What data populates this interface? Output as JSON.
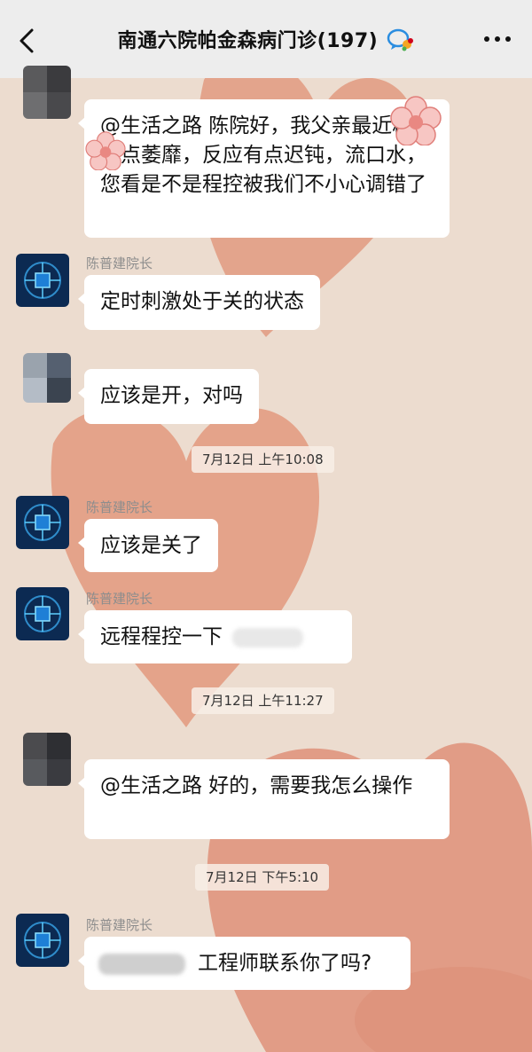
{
  "header": {
    "title": "南通六院帕金森病门诊(197)",
    "back_icon": "chevron-left-icon",
    "more_icon": "more-dots-icon",
    "badge_icon": "chat-bubble-badge-icon"
  },
  "messages": [
    {
      "sender": "",
      "text": "@生活之路  陈院好，我父亲最近精神有点萎靡，反应有点迟钝，流口水，您看是不是程控被我们不小心调错了"
    },
    {
      "sender": "陈普建院长",
      "text": "定时刺激处于关的状态"
    },
    {
      "sender": "",
      "text": "应该是开，对吗"
    },
    {
      "time": "7月12日 上午10:08"
    },
    {
      "sender": "陈普建院长",
      "text": "应该是关了"
    },
    {
      "sender": "陈普建院长",
      "text": "远程程控一下"
    },
    {
      "time": "7月12日 上午11:27"
    },
    {
      "sender": "",
      "text": "@生活之路  好的，需要我怎么操作"
    },
    {
      "time": "7月12日 下午5:10"
    },
    {
      "sender": "陈普建院长",
      "text": "工程师联系你了吗?"
    }
  ],
  "colors": {
    "header_bg": "#ededed",
    "wallpaper": "#ecdccf",
    "heart": "#e59a82",
    "bubble": "#ffffff"
  }
}
